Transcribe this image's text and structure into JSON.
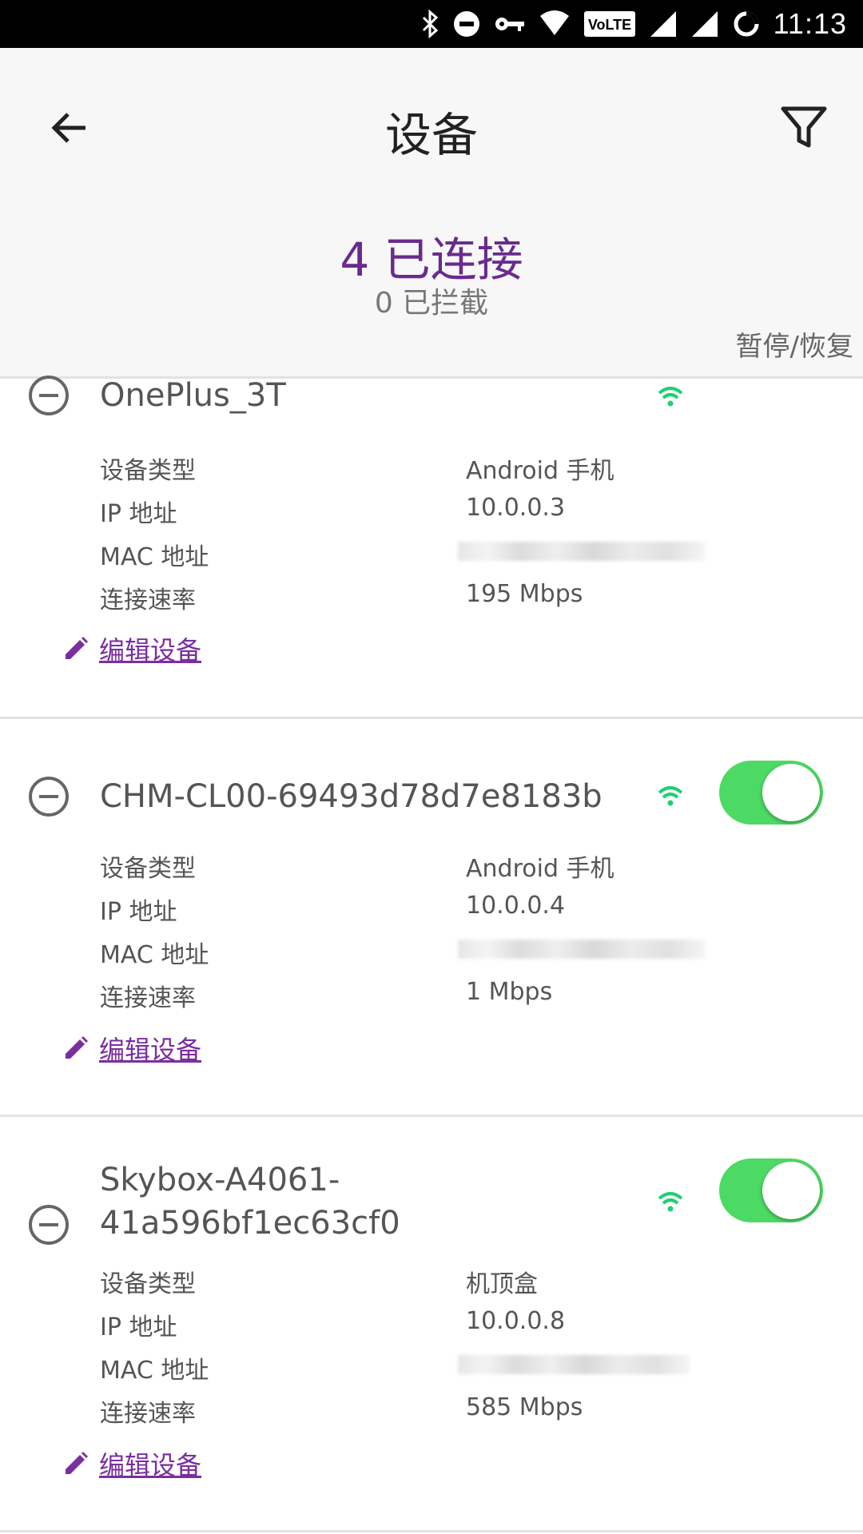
{
  "status_bar": {
    "time": "11:13",
    "network_badge": "VoLTE"
  },
  "header": {
    "title": "设备",
    "connected": "4 已连接",
    "blocked": "0 已拦截",
    "pause_resume": "暂停/恢复"
  },
  "labels": {
    "device_type": "设备类型",
    "ip": "IP 地址",
    "mac": "MAC 地址",
    "speed": "连接速率",
    "edit": "编辑设备"
  },
  "devices": [
    {
      "name": "OnePlus_3T",
      "type": "Android 手机",
      "ip": "10.0.0.3",
      "speed": "195 Mbps",
      "allowed": true
    },
    {
      "name": "CHM-CL00-69493d78d7e8183b",
      "type": "Android 手机",
      "ip": "10.0.0.4",
      "speed": "1 Mbps",
      "allowed": true
    },
    {
      "name_line1": "Skybox-A4061-",
      "name_line2": "41a596bf1ec63cf0",
      "type": "机顶盒",
      "ip": "10.0.0.8",
      "speed": "585 Mbps",
      "allowed": true
    }
  ],
  "colors": {
    "accent": "#6a2a8e",
    "toggle_on": "#4cd964",
    "wifi": "#1fcf72"
  },
  "icons": [
    "back-arrow-icon",
    "filter-icon",
    "remove-circle-icon",
    "wifi-icon",
    "pencil-icon"
  ]
}
